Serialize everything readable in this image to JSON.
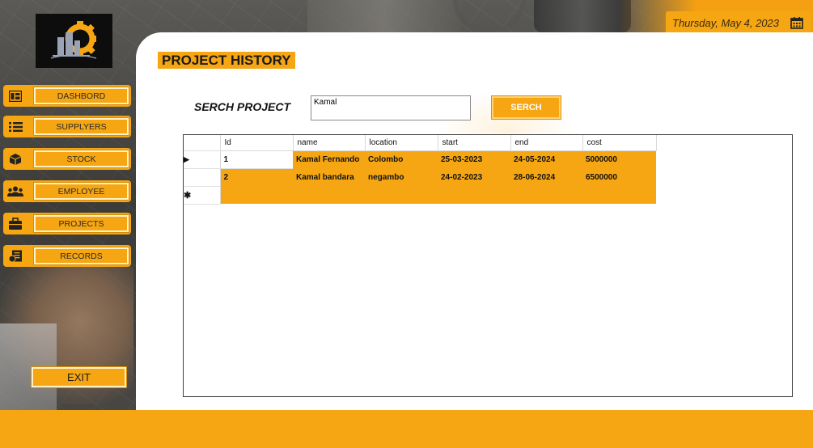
{
  "header": {
    "date": "Thursday, May 4, 2023"
  },
  "sidebar": {
    "items": [
      {
        "label": "DASHBORD",
        "icon": "dashboard-icon"
      },
      {
        "label": "SUPPLYERS",
        "icon": "list-icon"
      },
      {
        "label": "STOCK",
        "icon": "box-icon"
      },
      {
        "label": "EMPLOYEE",
        "icon": "people-icon"
      },
      {
        "label": "PROJECTS",
        "icon": "briefcase-icon"
      },
      {
        "label": "RECORDS",
        "icon": "records-icon"
      }
    ],
    "exit_label": "EXIT"
  },
  "main": {
    "title": "PROJECT HISTORY",
    "search_label": "SERCH PROJECT",
    "search_value": "Kamal",
    "search_button": "SERCH"
  },
  "grid": {
    "columns": [
      "Id",
      "name",
      "location",
      "start",
      "end",
      "cost"
    ],
    "rows": [
      [
        "1",
        "Kamal Fernando",
        "Colombo",
        "25-03-2023",
        "24-05-2024",
        "5000000"
      ],
      [
        "2",
        "Kamal bandara",
        "negambo",
        "24-02-2023",
        "28-06-2024",
        "6500000"
      ]
    ]
  },
  "colors": {
    "accent": "#f5a612",
    "panel": "#ffffff",
    "logo_bg": "#0d0d0d"
  }
}
